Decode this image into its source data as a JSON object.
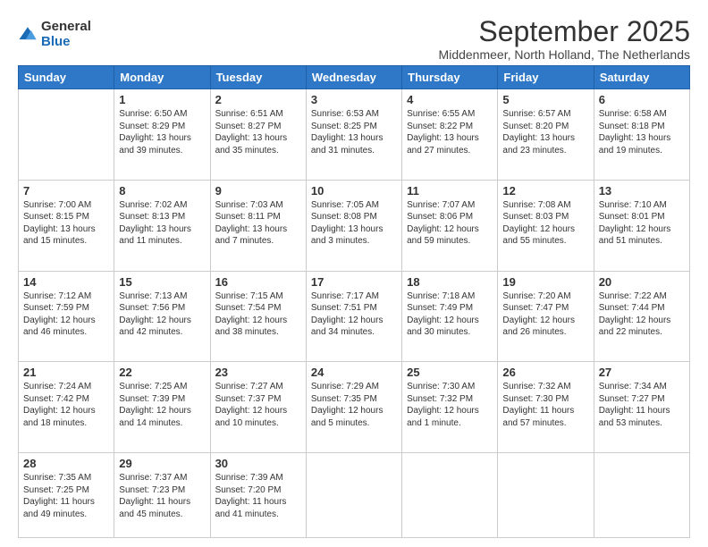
{
  "logo": {
    "general": "General",
    "blue": "Blue"
  },
  "header": {
    "month": "September 2025",
    "location": "Middenmeer, North Holland, The Netherlands"
  },
  "weekdays": [
    "Sunday",
    "Monday",
    "Tuesday",
    "Wednesday",
    "Thursday",
    "Friday",
    "Saturday"
  ],
  "weeks": [
    [
      {
        "day": "",
        "content": ""
      },
      {
        "day": "1",
        "content": "Sunrise: 6:50 AM\nSunset: 8:29 PM\nDaylight: 13 hours\nand 39 minutes."
      },
      {
        "day": "2",
        "content": "Sunrise: 6:51 AM\nSunset: 8:27 PM\nDaylight: 13 hours\nand 35 minutes."
      },
      {
        "day": "3",
        "content": "Sunrise: 6:53 AM\nSunset: 8:25 PM\nDaylight: 13 hours\nand 31 minutes."
      },
      {
        "day": "4",
        "content": "Sunrise: 6:55 AM\nSunset: 8:22 PM\nDaylight: 13 hours\nand 27 minutes."
      },
      {
        "day": "5",
        "content": "Sunrise: 6:57 AM\nSunset: 8:20 PM\nDaylight: 13 hours\nand 23 minutes."
      },
      {
        "day": "6",
        "content": "Sunrise: 6:58 AM\nSunset: 8:18 PM\nDaylight: 13 hours\nand 19 minutes."
      }
    ],
    [
      {
        "day": "7",
        "content": "Sunrise: 7:00 AM\nSunset: 8:15 PM\nDaylight: 13 hours\nand 15 minutes."
      },
      {
        "day": "8",
        "content": "Sunrise: 7:02 AM\nSunset: 8:13 PM\nDaylight: 13 hours\nand 11 minutes."
      },
      {
        "day": "9",
        "content": "Sunrise: 7:03 AM\nSunset: 8:11 PM\nDaylight: 13 hours\nand 7 minutes."
      },
      {
        "day": "10",
        "content": "Sunrise: 7:05 AM\nSunset: 8:08 PM\nDaylight: 13 hours\nand 3 minutes."
      },
      {
        "day": "11",
        "content": "Sunrise: 7:07 AM\nSunset: 8:06 PM\nDaylight: 12 hours\nand 59 minutes."
      },
      {
        "day": "12",
        "content": "Sunrise: 7:08 AM\nSunset: 8:03 PM\nDaylight: 12 hours\nand 55 minutes."
      },
      {
        "day": "13",
        "content": "Sunrise: 7:10 AM\nSunset: 8:01 PM\nDaylight: 12 hours\nand 51 minutes."
      }
    ],
    [
      {
        "day": "14",
        "content": "Sunrise: 7:12 AM\nSunset: 7:59 PM\nDaylight: 12 hours\nand 46 minutes."
      },
      {
        "day": "15",
        "content": "Sunrise: 7:13 AM\nSunset: 7:56 PM\nDaylight: 12 hours\nand 42 minutes."
      },
      {
        "day": "16",
        "content": "Sunrise: 7:15 AM\nSunset: 7:54 PM\nDaylight: 12 hours\nand 38 minutes."
      },
      {
        "day": "17",
        "content": "Sunrise: 7:17 AM\nSunset: 7:51 PM\nDaylight: 12 hours\nand 34 minutes."
      },
      {
        "day": "18",
        "content": "Sunrise: 7:18 AM\nSunset: 7:49 PM\nDaylight: 12 hours\nand 30 minutes."
      },
      {
        "day": "19",
        "content": "Sunrise: 7:20 AM\nSunset: 7:47 PM\nDaylight: 12 hours\nand 26 minutes."
      },
      {
        "day": "20",
        "content": "Sunrise: 7:22 AM\nSunset: 7:44 PM\nDaylight: 12 hours\nand 22 minutes."
      }
    ],
    [
      {
        "day": "21",
        "content": "Sunrise: 7:24 AM\nSunset: 7:42 PM\nDaylight: 12 hours\nand 18 minutes."
      },
      {
        "day": "22",
        "content": "Sunrise: 7:25 AM\nSunset: 7:39 PM\nDaylight: 12 hours\nand 14 minutes."
      },
      {
        "day": "23",
        "content": "Sunrise: 7:27 AM\nSunset: 7:37 PM\nDaylight: 12 hours\nand 10 minutes."
      },
      {
        "day": "24",
        "content": "Sunrise: 7:29 AM\nSunset: 7:35 PM\nDaylight: 12 hours\nand 5 minutes."
      },
      {
        "day": "25",
        "content": "Sunrise: 7:30 AM\nSunset: 7:32 PM\nDaylight: 12 hours\nand 1 minute."
      },
      {
        "day": "26",
        "content": "Sunrise: 7:32 AM\nSunset: 7:30 PM\nDaylight: 11 hours\nand 57 minutes."
      },
      {
        "day": "27",
        "content": "Sunrise: 7:34 AM\nSunset: 7:27 PM\nDaylight: 11 hours\nand 53 minutes."
      }
    ],
    [
      {
        "day": "28",
        "content": "Sunrise: 7:35 AM\nSunset: 7:25 PM\nDaylight: 11 hours\nand 49 minutes."
      },
      {
        "day": "29",
        "content": "Sunrise: 7:37 AM\nSunset: 7:23 PM\nDaylight: 11 hours\nand 45 minutes."
      },
      {
        "day": "30",
        "content": "Sunrise: 7:39 AM\nSunset: 7:20 PM\nDaylight: 11 hours\nand 41 minutes."
      },
      {
        "day": "",
        "content": ""
      },
      {
        "day": "",
        "content": ""
      },
      {
        "day": "",
        "content": ""
      },
      {
        "day": "",
        "content": ""
      }
    ]
  ]
}
